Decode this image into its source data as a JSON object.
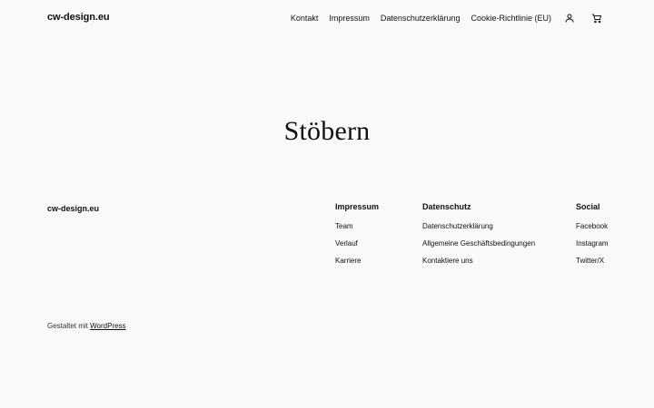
{
  "header": {
    "site_title": "cw-design.eu",
    "nav": [
      "Kontakt",
      "Impressum",
      "Datenschutzerklärung",
      "Cookie-Richtlinie (EU)"
    ],
    "icons": [
      "user-icon",
      "cart-icon"
    ]
  },
  "main": {
    "title": "Stöbern"
  },
  "footer": {
    "site_title": "cw-design.eu",
    "columns": [
      {
        "heading": "Impressum",
        "items": [
          "Team",
          "Verlauf",
          "Karriere"
        ]
      },
      {
        "heading": "Datenschutz",
        "items": [
          "Datenschutzerklärung",
          "Allgemeine Geschäftsbedingungen",
          "Kontaktiere uns"
        ]
      },
      {
        "heading": "Social",
        "items": [
          "Facebook",
          "Instagram",
          "Twitter/X"
        ]
      }
    ],
    "credit_prefix": "Gestaltet mit",
    "credit_link": "WordPress"
  }
}
